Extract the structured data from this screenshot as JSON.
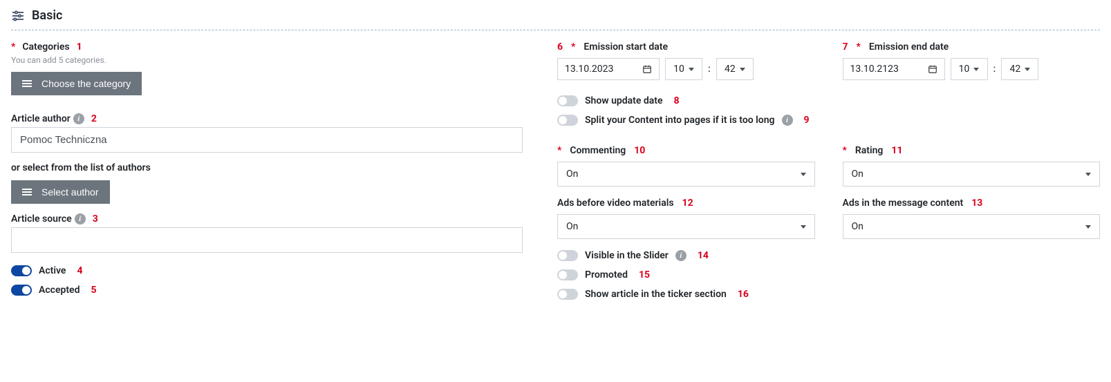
{
  "section": {
    "title": "Basic"
  },
  "left": {
    "categories": {
      "label": "Categories",
      "annot": "1",
      "hint": "You can add 5 categories.",
      "button": "Choose the category"
    },
    "author": {
      "label": "Article author",
      "annot": "2",
      "value": "Pomoc Techniczna",
      "alt_label": "or select from the list of authors",
      "select_button": "Select author"
    },
    "source": {
      "label": "Article source",
      "annot": "3",
      "value": ""
    },
    "active": {
      "label": "Active",
      "annot": "4",
      "on": true
    },
    "accepted": {
      "label": "Accepted",
      "annot": "5",
      "on": true
    }
  },
  "right": {
    "start": {
      "label": "Emission start date",
      "annot": "6",
      "date": "13.10.2023",
      "hour": "10",
      "minute": "42"
    },
    "end": {
      "label": "Emission end date",
      "annot": "7",
      "date": "13.10.2123",
      "hour": "10",
      "minute": "42"
    },
    "show_update": {
      "label": "Show update date",
      "annot": "8",
      "on": false
    },
    "split_pages": {
      "label": "Split your Content into pages if it is too long",
      "annot": "9",
      "on": false
    },
    "commenting": {
      "label": "Commenting",
      "annot": "10",
      "value": "On"
    },
    "rating": {
      "label": "Rating",
      "annot": "11",
      "value": "On"
    },
    "ads_video": {
      "label": "Ads before video materials",
      "annot": "12",
      "value": "On"
    },
    "ads_msg": {
      "label": "Ads in the message content",
      "annot": "13",
      "value": "On"
    },
    "visible_slider": {
      "label": "Visible in the Slider",
      "annot": "14",
      "on": false
    },
    "promoted": {
      "label": "Promoted",
      "annot": "15",
      "on": false
    },
    "ticker": {
      "label": "Show article in the ticker section",
      "annot": "16",
      "on": false
    }
  }
}
